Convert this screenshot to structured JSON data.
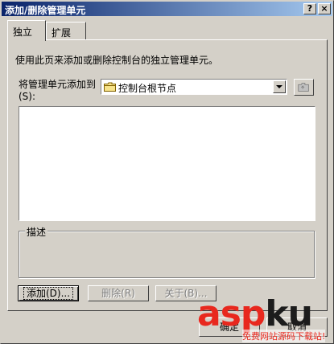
{
  "window": {
    "title": "添加/删除管理单元",
    "help_btn": "?",
    "close_btn": "×"
  },
  "tabs": [
    {
      "label": "独立",
      "active": true
    },
    {
      "label": "扩展",
      "active": false
    }
  ],
  "standalone": {
    "description": "使用此页来添加或删除控制台的独立管理单元。",
    "add_to_label": "将管理单元添加到(S):",
    "combo_value": "控制台根节点"
  },
  "description_group": {
    "label": "描述"
  },
  "buttons": {
    "add": "添加(D)...",
    "remove": "删除(R)",
    "about": "关于(B)..."
  },
  "bottom_buttons": {
    "ok": "确定",
    "cancel": "取消"
  },
  "watermark": {
    "brand_a": "asp",
    "brand_b": "ku",
    "tagline": "免费网站源码下载站!"
  },
  "colors": {
    "titlebar_start": "#0a246a",
    "titlebar_end": "#a6caf0",
    "face": "#d4d0c8",
    "watermark_red": "#e8281e"
  }
}
